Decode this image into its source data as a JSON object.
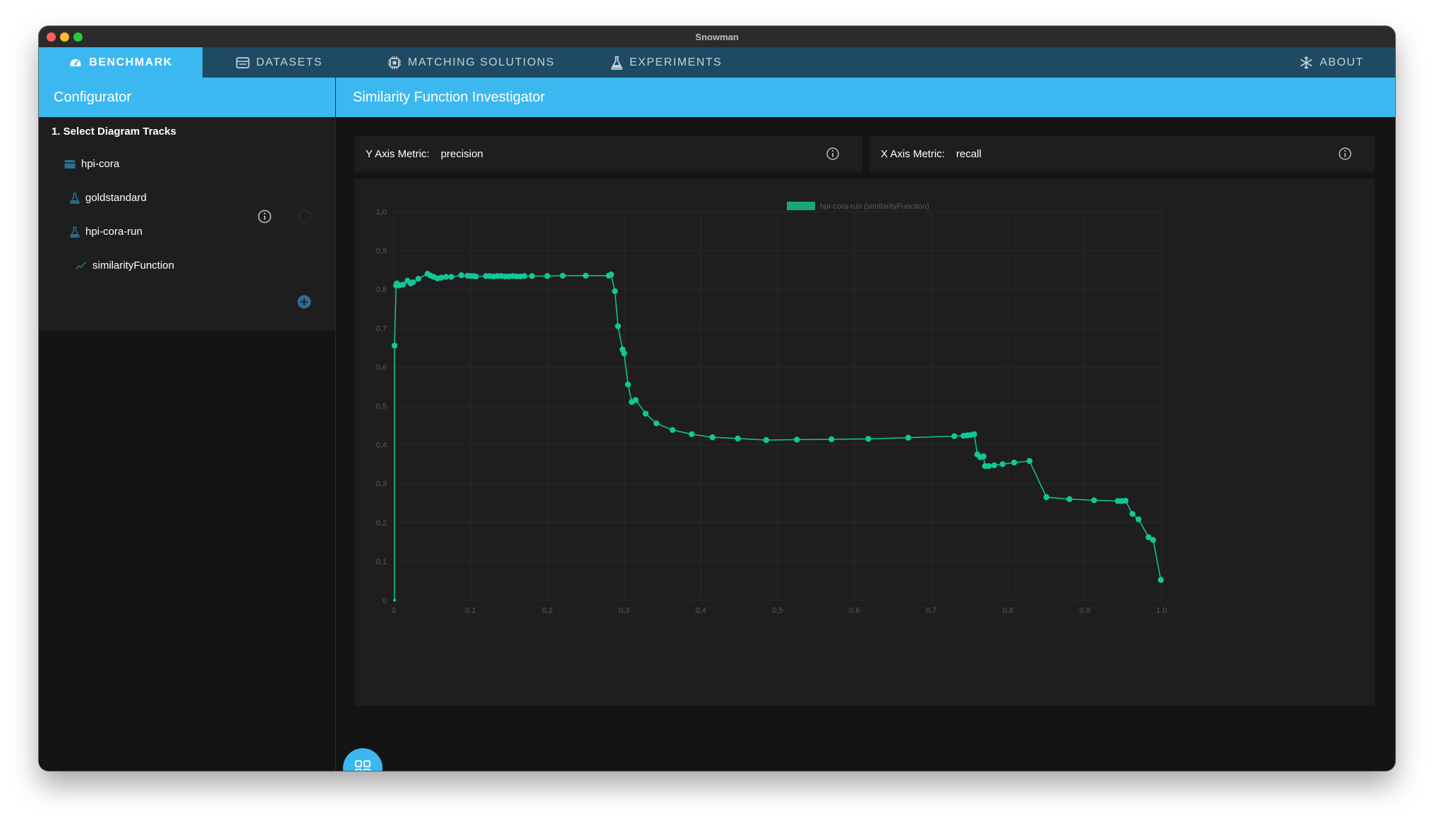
{
  "window": {
    "title": "Snowman"
  },
  "nav": {
    "tabs": [
      {
        "label": "BENCHMARK",
        "icon": "speedometer-icon",
        "active": true
      },
      {
        "label": "DATASETS",
        "icon": "dataset-icon"
      },
      {
        "label": "MATCHING SOLUTIONS",
        "icon": "chip-icon"
      },
      {
        "label": "EXPERIMENTS",
        "icon": "flask-icon"
      }
    ],
    "about": {
      "label": "ABOUT",
      "icon": "snowflake-icon"
    }
  },
  "sidebar": {
    "title": "Configurator",
    "section_title": "1. Select Diagram Tracks",
    "tracks": [
      {
        "label": "hpi-cora",
        "icon": "dataset-icon"
      },
      {
        "label": "goldstandard",
        "icon": "flask-icon"
      },
      {
        "label": "hpi-cora-run",
        "icon": "flask-icon"
      },
      {
        "label": "similarityFunction",
        "icon": "line-chart-icon"
      }
    ]
  },
  "main": {
    "title": "Similarity Function Investigator",
    "y_metric": {
      "label": "Y Axis Metric:",
      "value": "precision"
    },
    "x_metric": {
      "label": "X Axis Metric:",
      "value": "recall"
    }
  },
  "colors": {
    "accent": "#3cb8f0",
    "nav": "#1e4a63",
    "series": "#10c896",
    "legend": "#1aa67a"
  },
  "chart_data": {
    "type": "scatter",
    "title": "",
    "xlabel": "recall",
    "ylabel": "precision",
    "xlim": [
      0,
      1.0
    ],
    "ylim": [
      0,
      1.0
    ],
    "x_ticks": [
      "0",
      "0,1",
      "0,2",
      "0,3",
      "0,4",
      "0,5",
      "0,6",
      "0,7",
      "0,8",
      "0,9",
      "1,0"
    ],
    "y_ticks": [
      "0",
      "0,1",
      "0,2",
      "0,3",
      "0,4",
      "0,5",
      "0,6",
      "0,7",
      "0,8",
      "0,9",
      "1,0"
    ],
    "grid": true,
    "legend_position": "top-center",
    "series": [
      {
        "name": "hpi-cora-run (similarityFunction)",
        "points": [
          [
            0.001,
            0.0
          ],
          [
            0.001,
            0.655
          ],
          [
            0.003,
            0.81
          ],
          [
            0.004,
            0.815
          ],
          [
            0.007,
            0.81
          ],
          [
            0.012,
            0.812
          ],
          [
            0.018,
            0.822
          ],
          [
            0.022,
            0.815
          ],
          [
            0.025,
            0.818
          ],
          [
            0.032,
            0.827
          ],
          [
            0.044,
            0.84
          ],
          [
            0.048,
            0.835
          ],
          [
            0.052,
            0.832
          ],
          [
            0.057,
            0.828
          ],
          [
            0.062,
            0.83
          ],
          [
            0.068,
            0.832
          ],
          [
            0.075,
            0.832
          ],
          [
            0.088,
            0.836
          ],
          [
            0.096,
            0.835
          ],
          [
            0.1,
            0.834
          ],
          [
            0.104,
            0.834
          ],
          [
            0.107,
            0.833
          ],
          [
            0.12,
            0.834
          ],
          [
            0.125,
            0.834
          ],
          [
            0.13,
            0.833
          ],
          [
            0.135,
            0.834
          ],
          [
            0.14,
            0.834
          ],
          [
            0.145,
            0.833
          ],
          [
            0.15,
            0.833
          ],
          [
            0.155,
            0.834
          ],
          [
            0.16,
            0.833
          ],
          [
            0.165,
            0.833
          ],
          [
            0.17,
            0.834
          ],
          [
            0.18,
            0.834
          ],
          [
            0.2,
            0.834
          ],
          [
            0.22,
            0.835
          ],
          [
            0.25,
            0.835
          ],
          [
            0.28,
            0.835
          ],
          [
            0.283,
            0.838
          ],
          [
            0.288,
            0.795
          ],
          [
            0.292,
            0.705
          ],
          [
            0.298,
            0.645
          ],
          [
            0.3,
            0.635
          ],
          [
            0.305,
            0.555
          ],
          [
            0.31,
            0.51
          ],
          [
            0.315,
            0.515
          ],
          [
            0.328,
            0.48
          ],
          [
            0.342,
            0.455
          ],
          [
            0.363,
            0.438
          ],
          [
            0.388,
            0.427
          ],
          [
            0.415,
            0.419
          ],
          [
            0.448,
            0.416
          ],
          [
            0.485,
            0.412
          ],
          [
            0.525,
            0.413
          ],
          [
            0.57,
            0.414
          ],
          [
            0.618,
            0.415
          ],
          [
            0.67,
            0.418
          ],
          [
            0.73,
            0.422
          ],
          [
            0.742,
            0.423
          ],
          [
            0.747,
            0.424
          ],
          [
            0.751,
            0.425
          ],
          [
            0.756,
            0.427
          ],
          [
            0.76,
            0.375
          ],
          [
            0.764,
            0.368
          ],
          [
            0.768,
            0.37
          ],
          [
            0.77,
            0.345
          ],
          [
            0.775,
            0.345
          ],
          [
            0.782,
            0.347
          ],
          [
            0.793,
            0.35
          ],
          [
            0.808,
            0.354
          ],
          [
            0.828,
            0.358
          ],
          [
            0.85,
            0.265
          ],
          [
            0.88,
            0.26
          ],
          [
            0.912,
            0.257
          ],
          [
            0.943,
            0.255
          ],
          [
            0.948,
            0.255
          ],
          [
            0.953,
            0.256
          ],
          [
            0.962,
            0.222
          ],
          [
            0.97,
            0.208
          ],
          [
            0.983,
            0.162
          ],
          [
            0.989,
            0.155
          ],
          [
            0.999,
            0.052
          ]
        ]
      }
    ]
  }
}
